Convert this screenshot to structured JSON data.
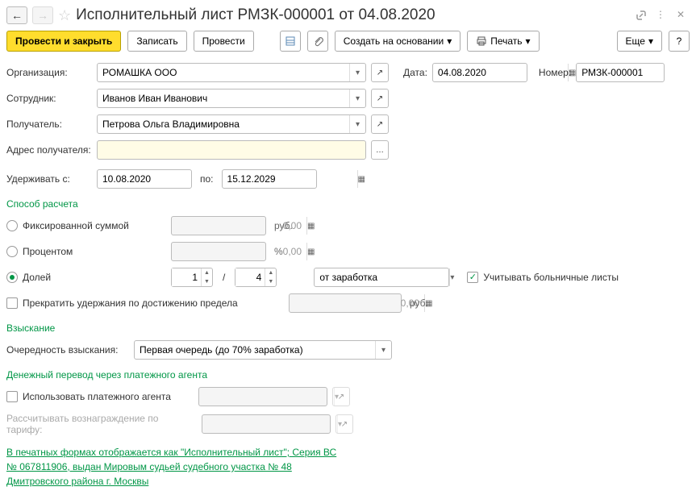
{
  "title": "Исполнительный лист РМЗК-000001 от 04.08.2020",
  "toolbar": {
    "post_close": "Провести и закрыть",
    "save": "Записать",
    "post": "Провести",
    "create_based": "Создать на основании",
    "print": "Печать",
    "more": "Еще",
    "help": "?"
  },
  "labels": {
    "org": "Организация:",
    "date": "Дата:",
    "number": "Номер:",
    "employee": "Сотрудник:",
    "recipient": "Получатель:",
    "recipient_addr": "Адрес получателя:",
    "withhold_from": "Удерживать с:",
    "to": "по:",
    "calc_method": "Способ расчета",
    "fixed": "Фиксированной суммой",
    "percent": "Процентом",
    "fraction": "Долей",
    "rub": "руб.",
    "pct": "%",
    "from_salary": "от заработка",
    "sick_leave": "Учитывать больничные листы",
    "stop_limit": "Прекратить удержания по достижению предела",
    "collection": "Взыскание",
    "queue_label": "Очередность взыскания:",
    "queue_value": "Первая очередь (до 70% заработка)",
    "transfer": "Денежный перевод через платежного агента",
    "use_agent": "Использовать платежного агента",
    "tariff": "Рассчитывать вознаграждение по тарифу:"
  },
  "values": {
    "org": "РОМАШКА ООО",
    "date": "04.08.2020",
    "number": "РМЗК-000001",
    "employee": "Иванов Иван Иванович",
    "recipient": "Петрова Ольга Владимировна",
    "recipient_addr": "",
    "date_from": "10.08.2020",
    "date_to": "15.12.2029",
    "fixed_amount": "0,00",
    "percent_amount": "0,00",
    "fraction_num": "1",
    "fraction_den": "4",
    "limit_amount": "0,00"
  },
  "footer": "В печатных формах отображается как \"Исполнительный лист\"; Серия ВС № 067811906, выдан Мировым судьей судебного участка № 48 Дмитровского района г. Москвы"
}
